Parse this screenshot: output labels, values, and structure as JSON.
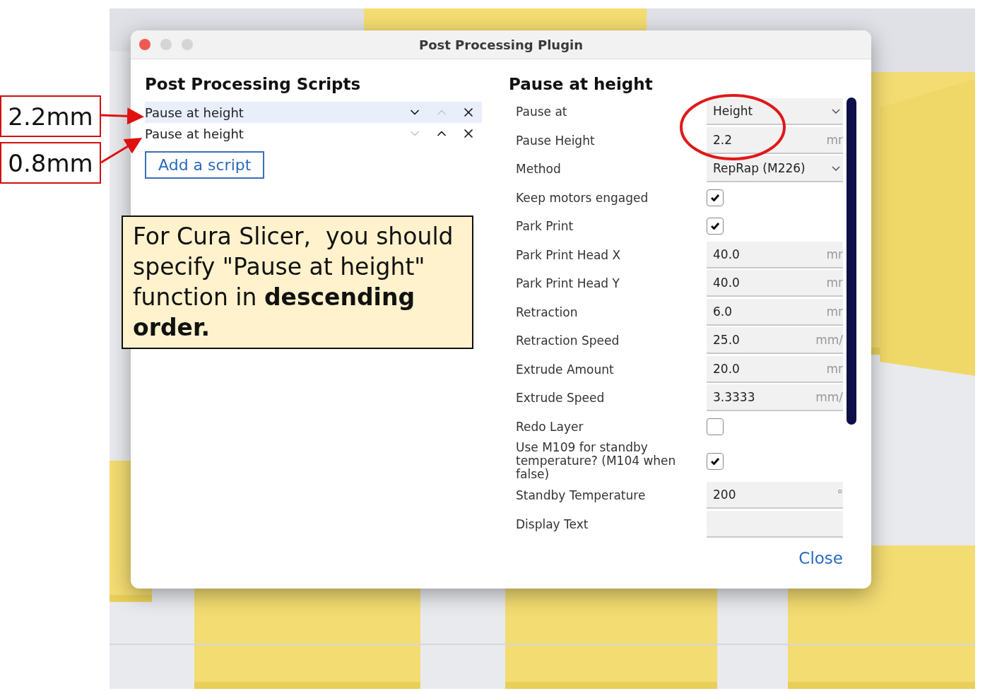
{
  "window": {
    "title": "Post Processing Plugin"
  },
  "scripts": {
    "title": "Post Processing Scripts",
    "items": [
      {
        "label": "Pause at height",
        "selected": true,
        "can_move_down": true,
        "can_move_up": false
      },
      {
        "label": "Pause at height",
        "selected": false,
        "can_move_down": false,
        "can_move_up": true
      }
    ],
    "add_button": "Add a script"
  },
  "settings": {
    "title": "Pause at height",
    "rows": [
      {
        "kind": "select",
        "label": "Pause at",
        "value": "Height"
      },
      {
        "kind": "number",
        "label": "Pause Height",
        "value": "2.2",
        "unit": "mr"
      },
      {
        "kind": "select",
        "label": "Method",
        "value": "RepRap (M226)"
      },
      {
        "kind": "checkbox",
        "label": "Keep motors engaged",
        "checked": true
      },
      {
        "kind": "checkbox",
        "label": "Park Print",
        "checked": true
      },
      {
        "kind": "number",
        "label": "Park Print Head X",
        "value": "40.0",
        "unit": "mr"
      },
      {
        "kind": "number",
        "label": "Park Print Head Y",
        "value": "40.0",
        "unit": "mr"
      },
      {
        "kind": "number",
        "label": "Retraction",
        "value": "6.0",
        "unit": "mr"
      },
      {
        "kind": "number",
        "label": "Retraction Speed",
        "value": "25.0",
        "unit": "mm/"
      },
      {
        "kind": "number",
        "label": "Extrude Amount",
        "value": "20.0",
        "unit": "mr"
      },
      {
        "kind": "number",
        "label": "Extrude Speed",
        "value": "3.3333",
        "unit": "mm/"
      },
      {
        "kind": "checkbox",
        "label": "Redo Layer",
        "checked": false
      },
      {
        "kind": "checkbox",
        "label": "Use M109 for standby temperature? (M104 when false)",
        "checked": true
      },
      {
        "kind": "number",
        "label": "Standby Temperature",
        "value": "200",
        "unit": "°"
      },
      {
        "kind": "text",
        "label": "Display Text"
      }
    ]
  },
  "close_button": "Close",
  "annotations": {
    "labels": [
      "2.2mm",
      "0.8mm"
    ],
    "note": "For Cura Slicer,  you should specify \"Pause at height\" function in **descending order.**"
  }
}
